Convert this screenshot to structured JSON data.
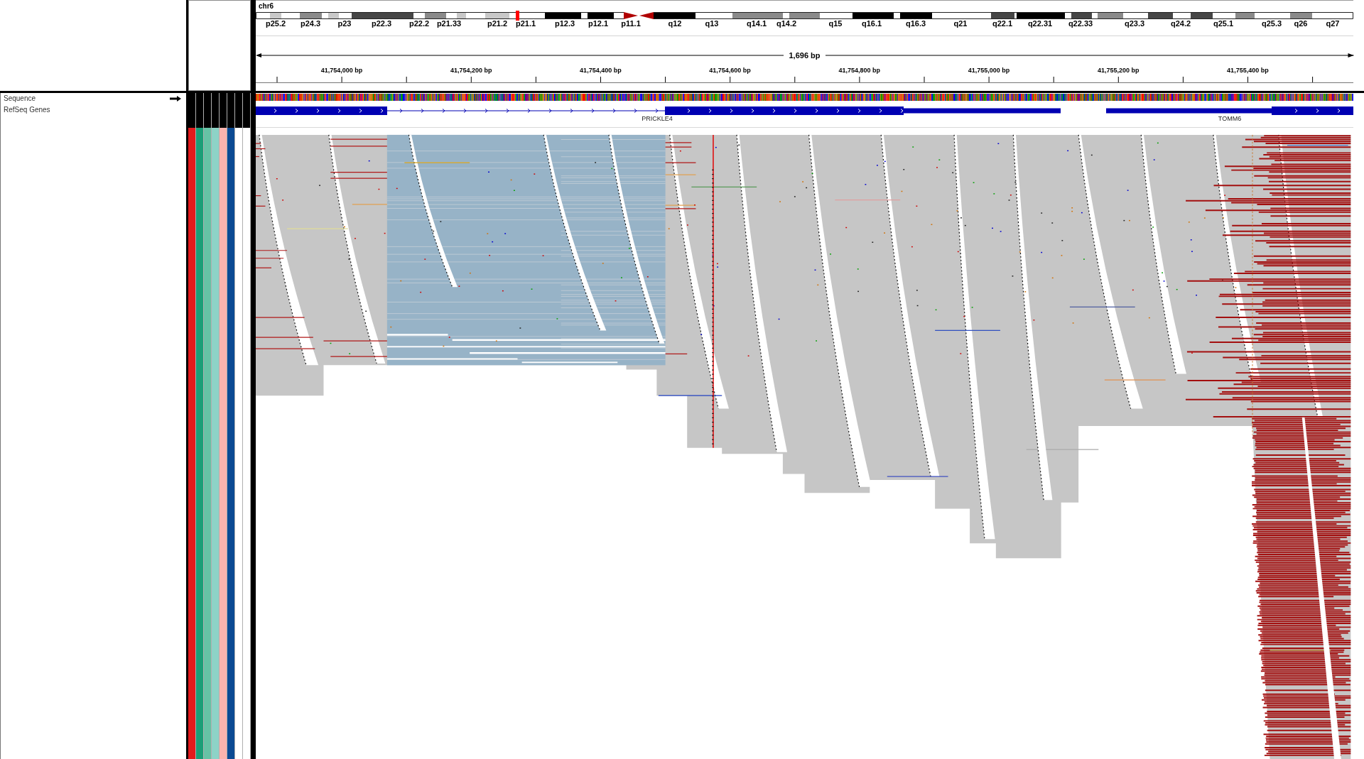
{
  "ideogram": {
    "chromosome": "chr6",
    "bands": [
      "p25.2",
      "p24.3",
      "p23",
      "p22.3",
      "p22.2",
      "p21.33",
      "p21.2",
      "p21.1",
      "p12.3",
      "p12.1",
      "p11.1",
      "q12",
      "q13",
      "q14.1",
      "q14.2",
      "q15",
      "q16.1",
      "q16.3",
      "q21",
      "q22.1",
      "q22.31",
      "q22.33",
      "q23.3",
      "q24.2",
      "q25.1",
      "q25.3",
      "q26",
      "q27"
    ]
  },
  "ruler": {
    "span": "1,696 bp",
    "ticks": [
      "41,754,000 bp",
      "41,754,200 bp",
      "41,754,400 bp",
      "41,754,600 bp",
      "41,754,800 bp",
      "41,755,000 bp",
      "41,755,200 bp",
      "41,755,400 bp"
    ]
  },
  "tracks": [
    {
      "name": "Sequence",
      "kind": "sequence"
    },
    {
      "name": "RefSeq Genes",
      "kind": "genes",
      "features": [
        {
          "name": "PRICKLE4"
        },
        {
          "name": "TOMM6"
        }
      ]
    }
  ],
  "attribute_columns": [
    {
      "color": "#e41a1c"
    },
    {
      "color": "#1b9e77"
    },
    {
      "color": "#66c2a5"
    },
    {
      "color": "#8dd3c7"
    },
    {
      "color": "#fbb4ae"
    },
    {
      "color": "#0b4a93"
    },
    {
      "color": "#ffffff"
    },
    {
      "color": "#ffffff"
    }
  ]
}
